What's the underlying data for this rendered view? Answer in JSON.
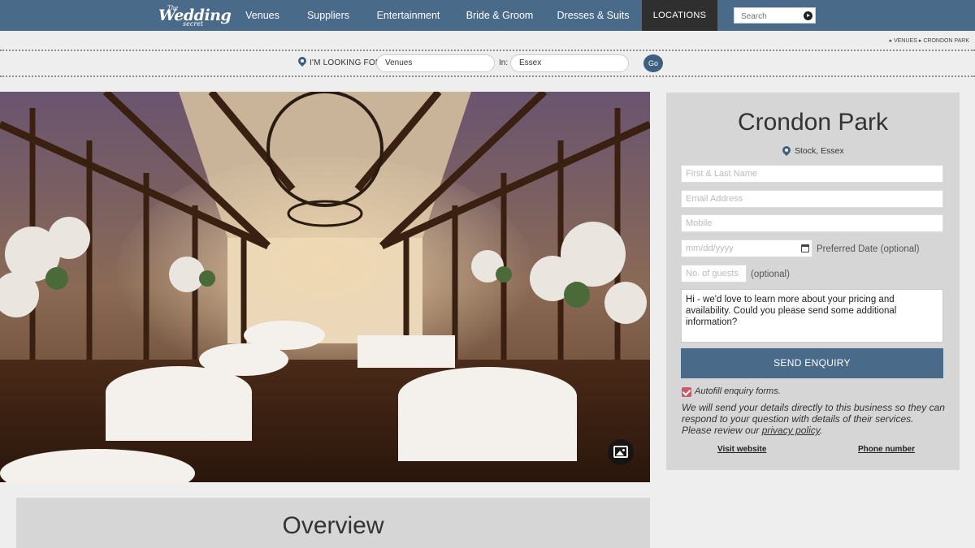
{
  "brand": {
    "logo_small": "The",
    "logo_main": "Wedding",
    "logo_tail": "secret"
  },
  "nav": {
    "items": [
      "Venues",
      "Suppliers",
      "Entertainment",
      "Bride & Groom",
      "Dresses & Suits",
      "LOCATIONS"
    ],
    "active": "LOCATIONS",
    "search_placeholder": "Search"
  },
  "breadcrumb": [
    "VENUES",
    "CRONDON PARK"
  ],
  "finder": {
    "label": "I'M LOOKING FOR:",
    "category_value": "Venues",
    "in_label": "In:",
    "location_value": "Essex",
    "go_label": "Go"
  },
  "venue": {
    "name": "Crondon Park",
    "location": "Stock, Essex"
  },
  "enquiry": {
    "name_placeholder": "First & Last Name",
    "email_placeholder": "Email Address",
    "mobile_placeholder": "Mobile",
    "date_placeholder": "mm/dd/yyyy",
    "date_label": "Preferred Date (optional)",
    "guests_placeholder": "No. of guests",
    "guests_label": "(optional)",
    "message": "Hi - we'd love to learn more about your pricing and availability. Could you please send some additional information?",
    "send_label": "SEND ENQUIRY",
    "autofill_label": "Autofill enquiry forms.",
    "autofill_checked": true,
    "disclaimer_pre": "We will send your details directly to this business so they can respond to your question with details of their services. Please review our ",
    "privacy_link": "privacy policy",
    "disclaimer_post": ".",
    "visit_website": "Visit website",
    "phone_number": "Phone number"
  },
  "overview": {
    "heading": "Overview"
  },
  "colors": {
    "nav_bg": "#4a6a8a",
    "nav_active": "#2f2f2f",
    "page_bg": "#eeeeee",
    "panel_bg": "#d6d6d6",
    "button": "#4a6a8a",
    "checkbox": "#c85a6a"
  },
  "icons": [
    "location-pin-icon",
    "play-arrow-icon",
    "calendar-icon",
    "gallery-icon",
    "checkmark-icon"
  ]
}
